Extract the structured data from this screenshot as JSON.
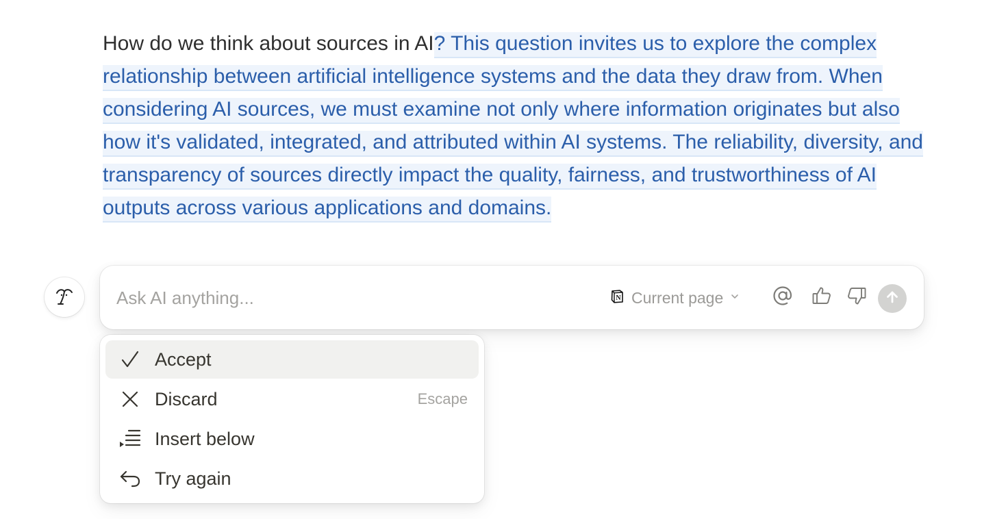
{
  "paragraph": {
    "prefix": "How do we think about sources in AI",
    "ai_continuation": "? This question invites us to explore the complex relationship between artificial intelligence systems and the data they draw from. When considering AI sources, we must examine not only where information originates but also how it's validated, integrated, and attributed within AI systems. The reliability, diversity, and transparency of sources directly impact the quality, fairness, and trustworthiness of AI outputs across various applications and domains."
  },
  "colors": {
    "ai_text": "#2b5eaa",
    "ai_highlight": "#eef4fc",
    "menu_active_bg": "#f1f1ef",
    "send_button": "#d3d3d1"
  },
  "prompt": {
    "placeholder": "Ask AI anything...",
    "value": "",
    "scope_icon": "notion-icon",
    "scope_label": "Current page",
    "scope_chevron": "chevron-down-icon",
    "mention_icon": "at-sign-icon",
    "like_icon": "thumbs-up-icon",
    "dislike_icon": "thumbs-down-icon",
    "send_icon": "arrow-up-icon"
  },
  "menu": {
    "items": [
      {
        "icon": "check-icon",
        "label": "Accept",
        "shortcut": ""
      },
      {
        "icon": "close-icon",
        "label": "Discard",
        "shortcut": "Escape"
      },
      {
        "icon": "insert-below-icon",
        "label": "Insert below",
        "shortcut": ""
      },
      {
        "icon": "undo-arrow-icon",
        "label": "Try again",
        "shortcut": ""
      }
    ]
  }
}
